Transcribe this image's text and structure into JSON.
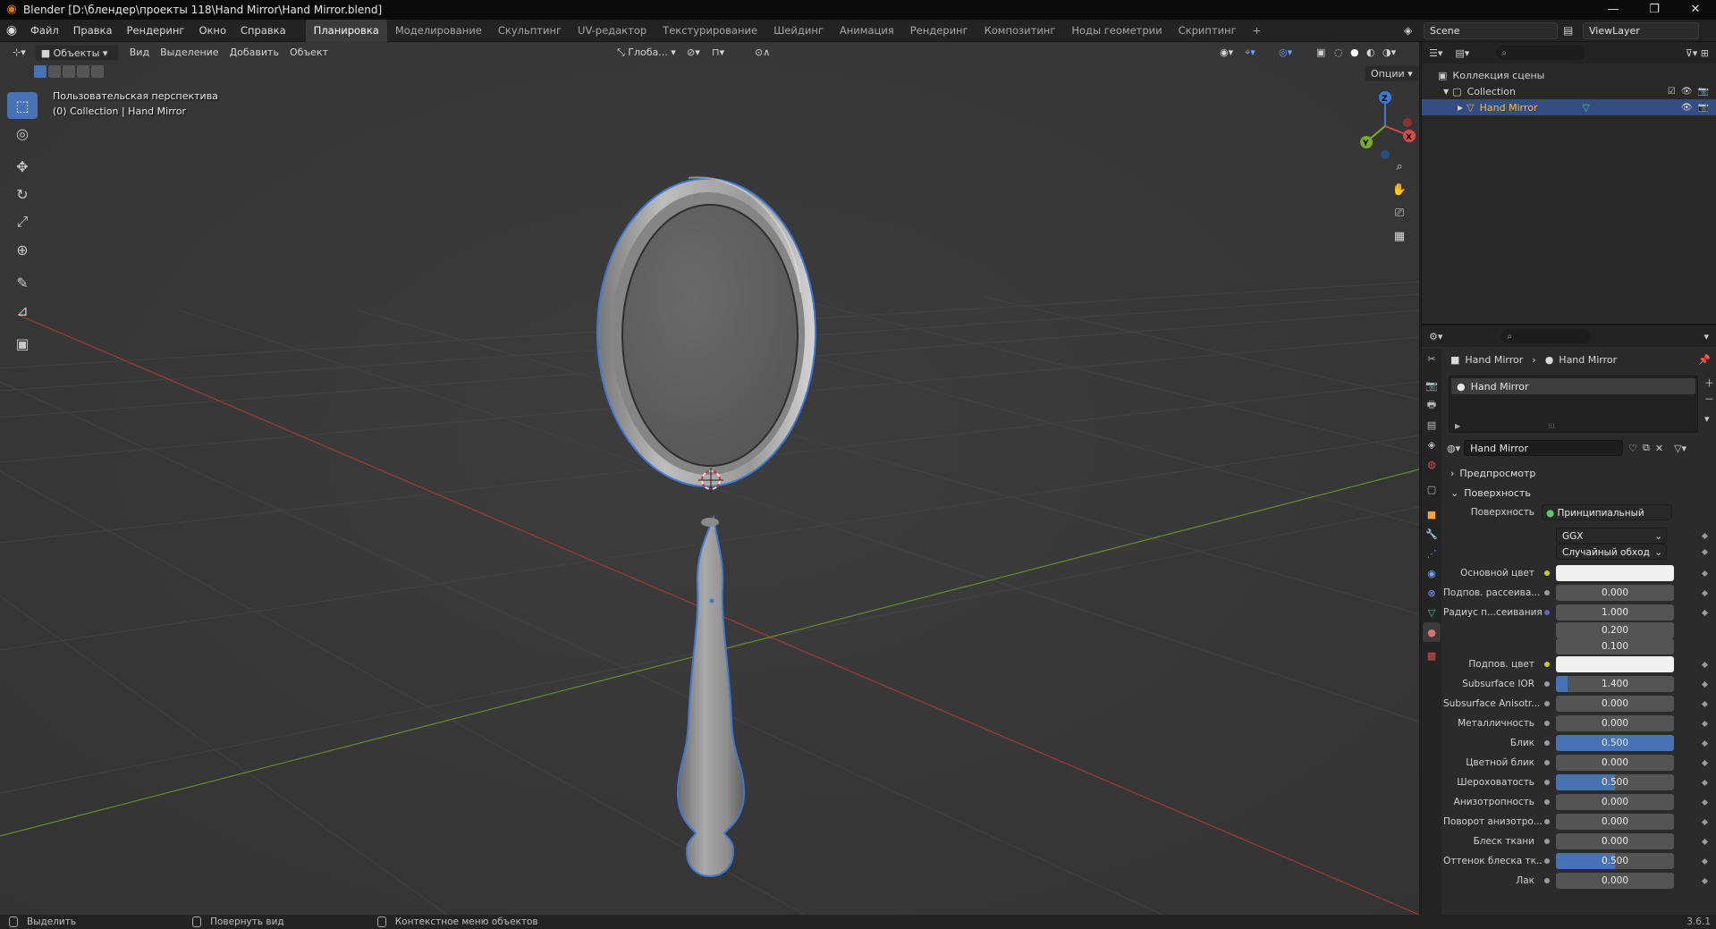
{
  "titlebar": {
    "title": "Blender [D:\\блендер\\проекты 118\\Hand Mirror\\Hand Mirror.blend]",
    "minimize": "—",
    "maximize": "❐",
    "close": "✕"
  },
  "menu": [
    "Файл",
    "Правка",
    "Рендеринг",
    "Окно",
    "Справка"
  ],
  "workspaces": [
    "Планировка",
    "Моделирование",
    "Скульптинг",
    "UV-редактор",
    "Текстурирование",
    "Шейдинг",
    "Анимация",
    "Рендеринг",
    "Композитинг",
    "Ноды геометрии",
    "Скриптинг"
  ],
  "workspace_add": "+",
  "scene": {
    "name": "Scene",
    "view_layer": "ViewLayer"
  },
  "viewport": {
    "mode": "Объекты",
    "menus": [
      "Вид",
      "Выделение",
      "Добавить",
      "Объект"
    ],
    "transform": "Глоба...",
    "options": "Опции",
    "perspective": "Пользовательская перспектива",
    "collection_info": "(0) Collection | Hand Mirror",
    "gizmo": {
      "z": "Z",
      "x": "X",
      "y": "Y"
    }
  },
  "outliner": {
    "root": "Коллекция сцены",
    "collection": "Collection",
    "object": "Hand Mirror"
  },
  "properties": {
    "breadcrumb_object": "Hand Mirror",
    "breadcrumb_material": "Hand Mirror",
    "slot": "Hand Mirror",
    "material_name": "Hand Mirror",
    "panel_preview": "Предпросмотр",
    "panel_surface": "Поверхность",
    "surface_label": "Поверхность",
    "surface_shader": "Принципиальный BSDF",
    "distribution": "GGX",
    "subsurface_method": "Случайный обход",
    "rows": [
      {
        "label": "Основной цвет",
        "type": "color",
        "socket": "yellow"
      },
      {
        "label": "Подпов. рассеива...",
        "value": "0.000",
        "fill": 0.0,
        "socket": "gray"
      },
      {
        "label": "Радиус п...сеивания",
        "value": "1.000",
        "fill": 0.0,
        "socket": "blue"
      },
      {
        "label": "",
        "value": "0.200",
        "fill": 0.0,
        "socket": "none"
      },
      {
        "label": "",
        "value": "0.100",
        "fill": 0.0,
        "socket": "none"
      },
      {
        "label": "Подпов. цвет",
        "type": "color",
        "socket": "yellow"
      },
      {
        "label": "Subsurface IOR",
        "value": "1.400",
        "fill": 0.1,
        "socket": "gray"
      },
      {
        "label": "Subsurface Anisotr...",
        "value": "0.000",
        "fill": 0.0,
        "socket": "gray"
      },
      {
        "label": "Металличность",
        "value": "0.000",
        "fill": 0.0,
        "socket": "gray"
      },
      {
        "label": "Блик",
        "value": "0.500",
        "fill": 1.0,
        "socket": "gray"
      },
      {
        "label": "Цветной блик",
        "value": "0.000",
        "fill": 0.0,
        "socket": "gray"
      },
      {
        "label": "Шероховатость",
        "value": "0.500",
        "fill": 0.5,
        "socket": "gray"
      },
      {
        "label": "Анизотропность",
        "value": "0.000",
        "fill": 0.0,
        "socket": "gray"
      },
      {
        "label": "Поворот анизотро...",
        "value": "0.000",
        "fill": 0.0,
        "socket": "gray"
      },
      {
        "label": "Блеск ткани",
        "value": "0.000",
        "fill": 0.0,
        "socket": "gray"
      },
      {
        "label": "Оттенок блеска тк...",
        "value": "0.500",
        "fill": 0.5,
        "socket": "gray"
      },
      {
        "label": "Лак",
        "value": "0.000",
        "fill": 0.0,
        "socket": "gray"
      }
    ]
  },
  "statusbar": {
    "select": "Выделить",
    "rotate": "Повернуть вид",
    "context": "Контекстное меню объектов",
    "version": "3.6.1"
  }
}
